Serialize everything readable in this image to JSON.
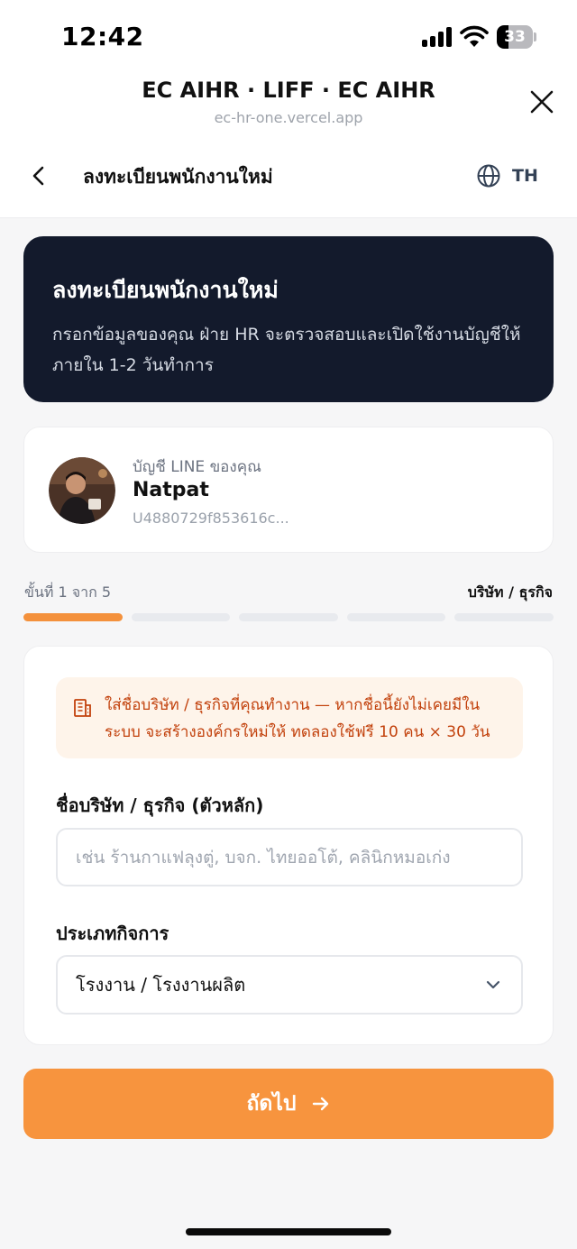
{
  "status_bar": {
    "time": "12:42",
    "battery_percent": "33",
    "battery_level": 0.33
  },
  "liff": {
    "title": "EC AIHR · LIFF · EC AIHR",
    "url": "ec-hr-one.vercel.app"
  },
  "nav": {
    "title": "ลงทะเบียนพนักงานใหม่",
    "lang": "TH"
  },
  "hero": {
    "title": "ลงทะเบียนพนักงานใหม่",
    "description": "กรอกข้อมูลของคุณ ฝ่าย HR จะตรวจสอบและเปิดใช้งานบัญชีให้ภายใน 1-2 วันทำการ"
  },
  "profile": {
    "label": "บัญชี LINE ของคุณ",
    "name": "Natpat",
    "user_id": "U4880729f853616c..."
  },
  "step": {
    "text": "ขั้นที่ 1 จาก 5",
    "current_section": "บริษัท / ธุรกิจ",
    "current": 1,
    "total": 5
  },
  "form": {
    "notice": "ใส่ชื่อบริษัท / ธุรกิจที่คุณทำงาน — หากชื่อนี้ยังไม่เคยมีในระบบ จะสร้างองค์กรใหม่ให้ ทดลองใช้ฟรี 10 คน × 30 วัน",
    "company_label": "ชื่อบริษัท / ธุรกิจ (ตัวหลัก)",
    "company_placeholder": "เช่น ร้านกาแฟลุงตู่, บจก. ไทยออโต้, คลินิกหมอเก่ง",
    "company_value": "",
    "business_type_label": "ประเภทกิจการ",
    "business_type_value": "โรงงาน / โรงงานผลิต"
  },
  "next_button": {
    "label": "ถัดไป"
  },
  "colors": {
    "accent": "#f7943e",
    "hero_bg": "#131a2c",
    "notice_bg": "#fef4ea",
    "notice_text": "#c2410c"
  },
  "icons": [
    "signal-icon",
    "wifi-icon",
    "battery-icon",
    "close-icon",
    "back-chevron-icon",
    "globe-icon",
    "building-icon",
    "chevron-down-icon",
    "arrow-right-icon"
  ]
}
